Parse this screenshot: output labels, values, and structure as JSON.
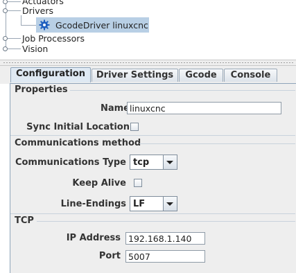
{
  "tree": {
    "items": [
      {
        "label": "Actuators"
      },
      {
        "label": "Drivers"
      },
      {
        "label": "GcodeDriver linuxcnc"
      },
      {
        "label": "Job Processors"
      },
      {
        "label": "Vision"
      }
    ]
  },
  "tabs": [
    {
      "label": "Configuration",
      "active": true
    },
    {
      "label": "Driver Settings",
      "active": false
    },
    {
      "label": "Gcode",
      "active": false
    },
    {
      "label": "Console",
      "active": false
    }
  ],
  "properties": {
    "title": "Properties",
    "name_label": "Name",
    "name_value": "linuxcnc",
    "sync_label": "Sync Initial Location",
    "sync_checked": false
  },
  "communications": {
    "title": "Communications method",
    "type_label": "Communications Type",
    "type_value": "tcp",
    "keepalive_label": "Keep Alive",
    "keepalive_checked": false,
    "line_endings_label": "Line-Endings",
    "line_endings_value": "LF"
  },
  "tcp": {
    "title": "TCP",
    "ip_label": "IP Address",
    "ip_value": "192.168.1.140",
    "port_label": "Port",
    "port_value": "5007"
  },
  "colors": {
    "selection": "#b8cfe5",
    "panel_bg": "#eeeeee",
    "gear_icon": "#1f5fbf"
  },
  "icons": {
    "tree_node_handle": "tree-handle-icon",
    "driver": "gear-icon",
    "combo_arrow": "chevron-down-icon"
  }
}
